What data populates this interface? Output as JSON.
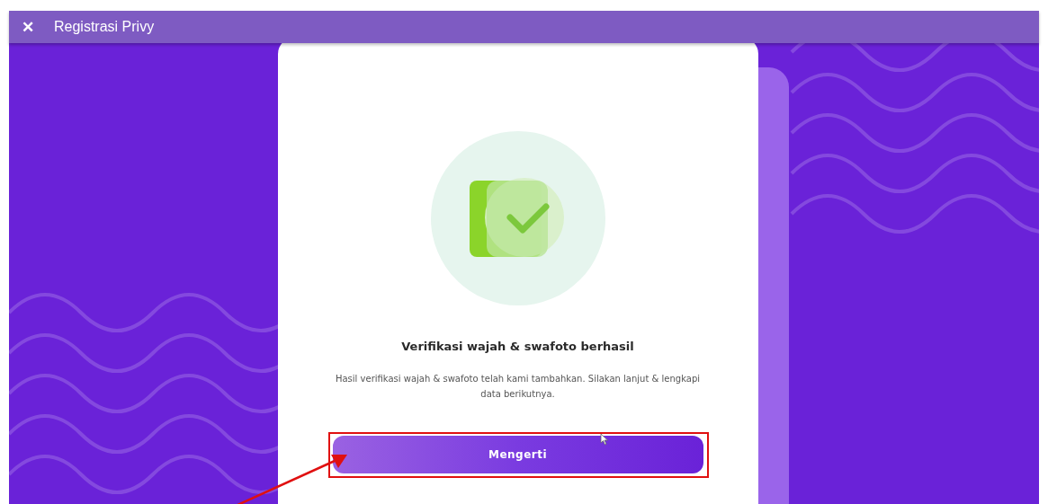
{
  "app_bar": {
    "close_icon": "✕",
    "title": "Registrasi Privy"
  },
  "card": {
    "title": "Verifikasi wajah & swafoto berhasil",
    "message": "Hasil verifikasi wajah & swafoto telah kami tambahkan. Silakan lanjut & lengkapi data berikutnya.",
    "button": "Mengerti"
  }
}
